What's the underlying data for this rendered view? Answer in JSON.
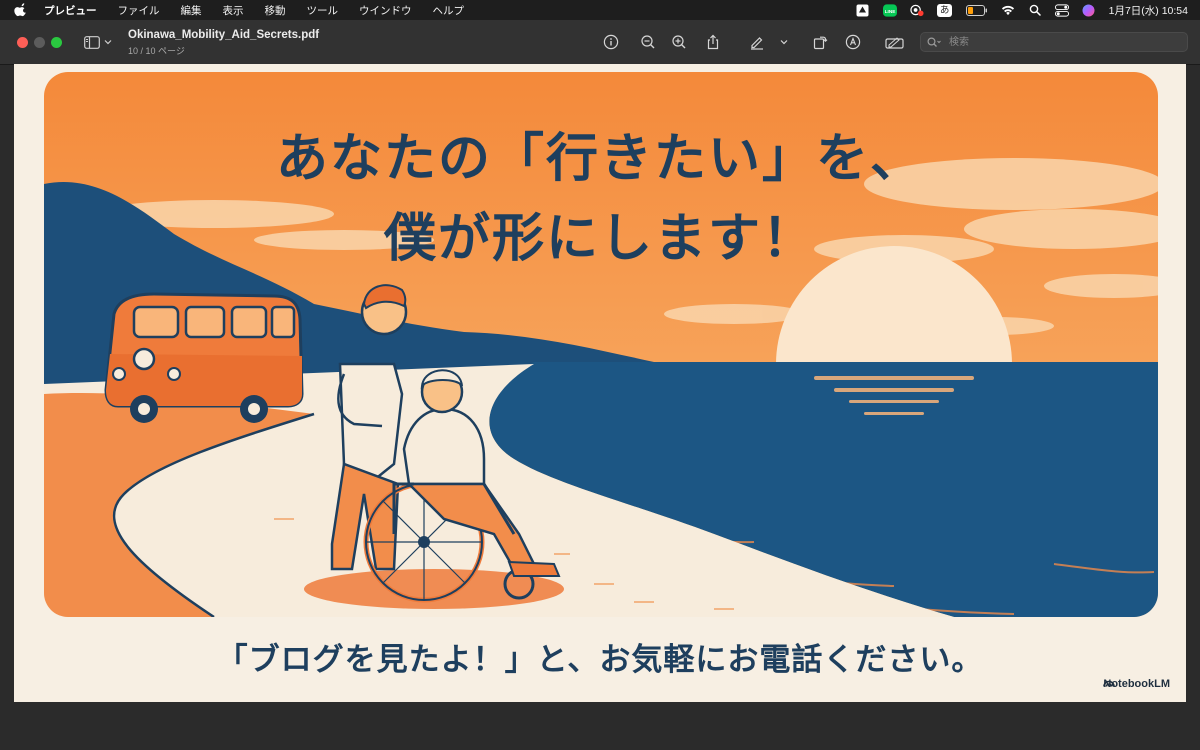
{
  "menubar": {
    "app_name": "プレビュー",
    "items": [
      "ファイル",
      "編集",
      "表示",
      "移動",
      "ツール",
      "ウインドウ",
      "ヘルプ"
    ],
    "ime_label": "あ",
    "line_badge": "LINE",
    "clock": "1月7日(水)  10:54"
  },
  "toolbar": {
    "doc_title": "Okinawa_Mobility_Aid_Secrets.pdf",
    "page_info": "10 / 10 ページ",
    "search_placeholder": "検索"
  },
  "slide": {
    "headline_line1": "あなたの「行きたい」を、",
    "headline_line2": "僕が形にします！",
    "cta": "「ブログを見たよ！」と、お気軽にお電話ください。",
    "brand": "NotebookLM"
  },
  "colors": {
    "sky_orange": "#f6903f",
    "sea_blue": "#1c5684",
    "navy": "#1e3f5e",
    "sand": "#f7efe3",
    "accent_orange": "#ef7b3b"
  }
}
